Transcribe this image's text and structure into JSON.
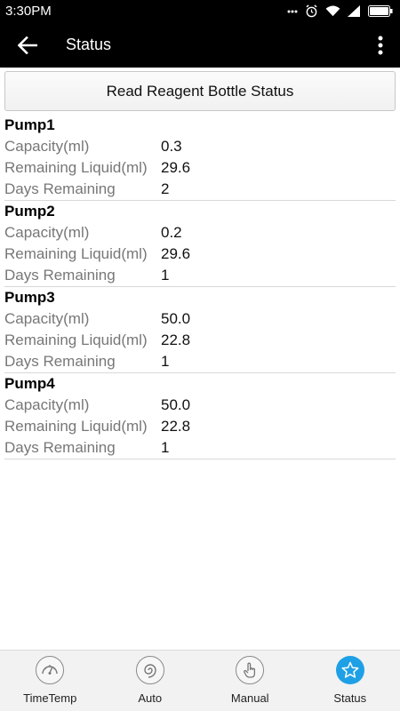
{
  "status_bar": {
    "time": "3:30PM"
  },
  "app_bar": {
    "title": "Status"
  },
  "read_button": {
    "label": "Read Reagent Bottle Status"
  },
  "pumps": [
    {
      "name": "Pump1",
      "rows": [
        {
          "label": "Capacity(ml)",
          "value": "0.3"
        },
        {
          "label": "Remaining Liquid(ml)",
          "value": "29.6"
        },
        {
          "label": "Days Remaining",
          "value": "2"
        }
      ]
    },
    {
      "name": "Pump2",
      "rows": [
        {
          "label": "Capacity(ml)",
          "value": "0.2"
        },
        {
          "label": "Remaining Liquid(ml)",
          "value": "29.6"
        },
        {
          "label": "Days Remaining",
          "value": "1"
        }
      ]
    },
    {
      "name": "Pump3",
      "rows": [
        {
          "label": "Capacity(ml)",
          "value": "50.0"
        },
        {
          "label": "Remaining Liquid(ml)",
          "value": "22.8"
        },
        {
          "label": "Days Remaining",
          "value": "1"
        }
      ]
    },
    {
      "name": "Pump4",
      "rows": [
        {
          "label": "Capacity(ml)",
          "value": "50.0"
        },
        {
          "label": "Remaining Liquid(ml)",
          "value": "22.8"
        },
        {
          "label": "Days Remaining",
          "value": "1"
        }
      ]
    }
  ],
  "bottom_nav": {
    "items": [
      {
        "label": "TimeTemp",
        "icon": "gauge-icon",
        "active": false
      },
      {
        "label": "Auto",
        "icon": "swirl-icon",
        "active": false
      },
      {
        "label": "Manual",
        "icon": "hand-pointer-icon",
        "active": false
      },
      {
        "label": "Status",
        "icon": "star-icon",
        "active": true
      }
    ]
  },
  "colors": {
    "bar_background": "#000000",
    "active_nav": "#1ea0e6",
    "label_text": "#777777"
  }
}
